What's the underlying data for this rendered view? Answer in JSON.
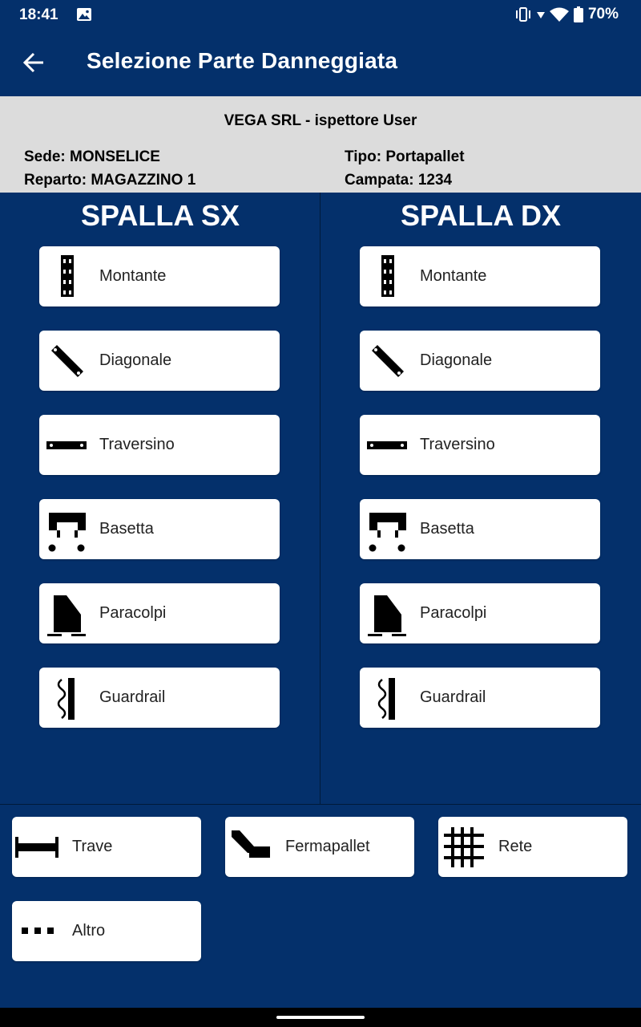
{
  "status_bar": {
    "time": "18:41",
    "battery": "70%"
  },
  "app_bar": {
    "title": "Selezione Parte Danneggiata"
  },
  "info": {
    "company": "VEGA SRL - ispettore User",
    "sede": "Sede: MONSELICE",
    "reparto": "Reparto: MAGAZZINO 1",
    "tipo": "Tipo: Portapallet",
    "campata": "Campata: 1234"
  },
  "left": {
    "title": "SPALLA SX",
    "items": [
      {
        "label": "Montante",
        "icon": "upright-icon"
      },
      {
        "label": "Diagonale",
        "icon": "diagonal-icon"
      },
      {
        "label": "Traversino",
        "icon": "crossbar-icon"
      },
      {
        "label": "Basetta",
        "icon": "baseplate-icon"
      },
      {
        "label": "Paracolpi",
        "icon": "bumper-icon"
      },
      {
        "label": "Guardrail",
        "icon": "guardrail-icon"
      }
    ]
  },
  "right": {
    "title": "SPALLA DX",
    "items": [
      {
        "label": "Montante",
        "icon": "upright-icon"
      },
      {
        "label": "Diagonale",
        "icon": "diagonal-icon"
      },
      {
        "label": "Traversino",
        "icon": "crossbar-icon"
      },
      {
        "label": "Basetta",
        "icon": "baseplate-icon"
      },
      {
        "label": "Paracolpi",
        "icon": "bumper-icon"
      },
      {
        "label": "Guardrail",
        "icon": "guardrail-icon"
      }
    ]
  },
  "bottom": {
    "items": [
      {
        "label": "Trave",
        "icon": "beam-icon"
      },
      {
        "label": "Fermapallet",
        "icon": "pallet-stop-icon"
      },
      {
        "label": "Rete",
        "icon": "mesh-icon"
      },
      {
        "label": "Altro",
        "icon": "more-icon"
      }
    ]
  },
  "colors": {
    "background": "#04306B",
    "panel": "#DCDCDC",
    "button": "#FFFFFF",
    "icon": "#000000"
  }
}
